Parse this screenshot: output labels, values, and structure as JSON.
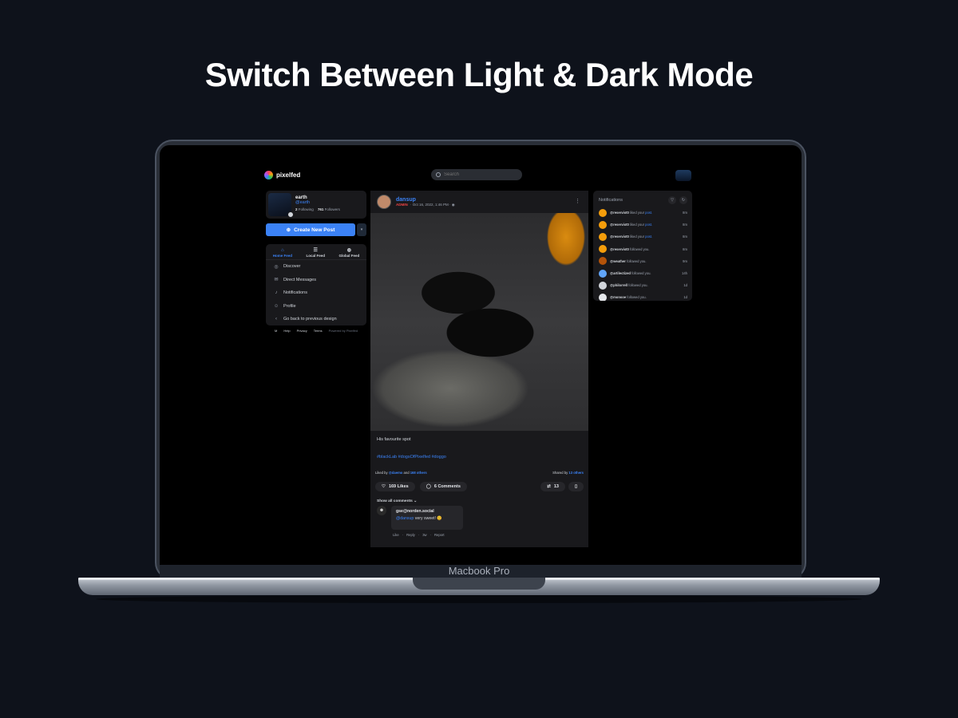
{
  "headline": "Switch Between Light & Dark Mode",
  "device_label": "Macbook Pro",
  "app": {
    "brand": "pixelfed",
    "search_placeholder": "Search"
  },
  "profile": {
    "name": "earth",
    "handle": "@earth",
    "following_count": "2",
    "following_label": "Following",
    "followers_count": "761",
    "followers_label": "Followers"
  },
  "create_button": {
    "label": "Create New Post",
    "icon": "plus-icon"
  },
  "feed_tabs": [
    {
      "label": "Home Feed",
      "icon": "home-icon"
    },
    {
      "label": "Local Feed",
      "icon": "list-icon"
    },
    {
      "label": "Global Feed",
      "icon": "globe-icon"
    }
  ],
  "nav": [
    {
      "label": "Discover",
      "icon": "compass-icon"
    },
    {
      "label": "Direct Messages",
      "icon": "mail-icon"
    },
    {
      "label": "Notifications",
      "icon": "bell-icon"
    },
    {
      "label": "Profile",
      "icon": "user-icon"
    },
    {
      "label": "Go back to previous design",
      "icon": "chevron-left-icon"
    }
  ],
  "footer": {
    "logo_text": "M",
    "links": [
      "Help",
      "Privacy",
      "Terms"
    ],
    "powered": "Powered by Pixelfed"
  },
  "post": {
    "username": "dansup",
    "role": "ADMIN",
    "timestamp": "Oct 16, 2022, 1:46 PM",
    "caption": "His favourite spot",
    "hashtags": "#blackLab #dogsOfPixelfed #doggo",
    "liked_by_prefix": "Liked by",
    "liked_by_user": "@daemo",
    "liked_by_and": "and",
    "liked_by_others": "168 others",
    "shared_prefix": "Shared by",
    "shared_others": "13 others",
    "likes_label": "169 Likes",
    "comments_label": "6 Comments",
    "shares_count": "13",
    "show_comments": "Show all comments",
    "comment": {
      "author": "gse@norden.social",
      "mention": "@dansup",
      "text": "very sweet! 😊",
      "actions": [
        "Like",
        "Reply",
        "3w",
        "Report"
      ]
    }
  },
  "notifications": {
    "title": "Notifications",
    "items": [
      {
        "user": "@reservist0",
        "action": "liked your",
        "link": "post.",
        "time": "8m",
        "color": "#f59e0b"
      },
      {
        "user": "@reservist0",
        "action": "liked your",
        "link": "post.",
        "time": "8m",
        "color": "#f59e0b"
      },
      {
        "user": "@reservist0",
        "action": "liked your",
        "link": "post.",
        "time": "8m",
        "color": "#f59e0b"
      },
      {
        "user": "@reservist0",
        "action": "followed you.",
        "link": "",
        "time": "8m",
        "color": "#f59e0b"
      },
      {
        "user": "@weather",
        "action": "followed you.",
        "link": "",
        "time": "9m",
        "color": "#b45309"
      },
      {
        "user": "@artilectized",
        "action": "followed you.",
        "link": "",
        "time": "14h",
        "color": "#60a5fa"
      },
      {
        "user": "@philorrell",
        "action": "followed you.",
        "link": "",
        "time": "1d",
        "color": "#d1d5db"
      },
      {
        "user": "@monsoe",
        "action": "followed you.",
        "link": "",
        "time": "1d",
        "color": "#e5e7eb"
      }
    ]
  }
}
